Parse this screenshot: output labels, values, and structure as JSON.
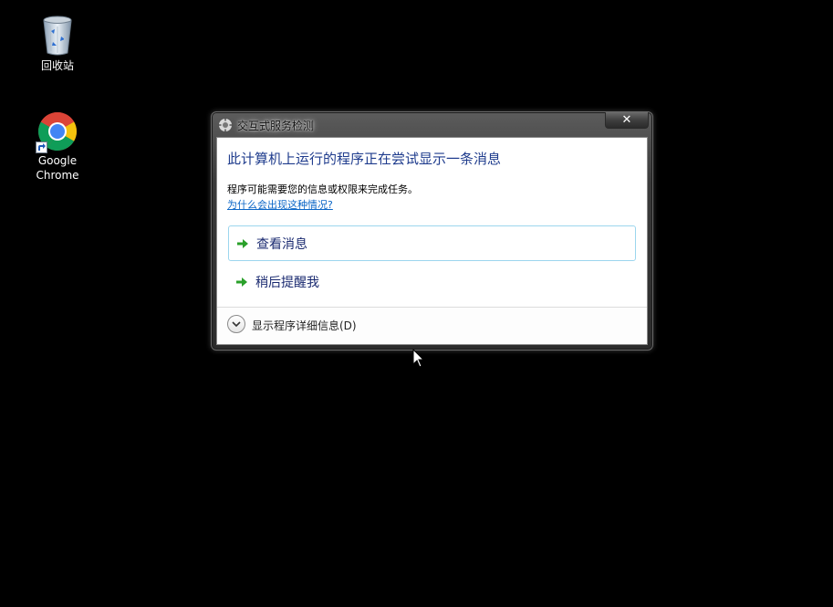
{
  "desktop": {
    "icons": [
      {
        "label": "回收站",
        "icon": "recycle-bin-icon"
      },
      {
        "label": "Google\nChrome",
        "icon": "chrome-icon"
      }
    ]
  },
  "dialog": {
    "title": "交互式服务检测",
    "close_label": "✕",
    "main_instruction": "此计算机上运行的程序正在尝试显示一条消息",
    "content": "程序可能需要您的信息或权限来完成任务。",
    "why_link": "为什么会出现这种情况?",
    "commands": [
      {
        "label": "查看消息"
      },
      {
        "label": "稍后提醒我"
      }
    ],
    "details_label": "显示程序详细信息(D)"
  },
  "colors": {
    "desktop_background": "#000000",
    "accent_text": "#1f3c8d",
    "link": "#0b66c7",
    "arrow_green": "#2aa02a",
    "hover_border": "#9cd6ee"
  }
}
